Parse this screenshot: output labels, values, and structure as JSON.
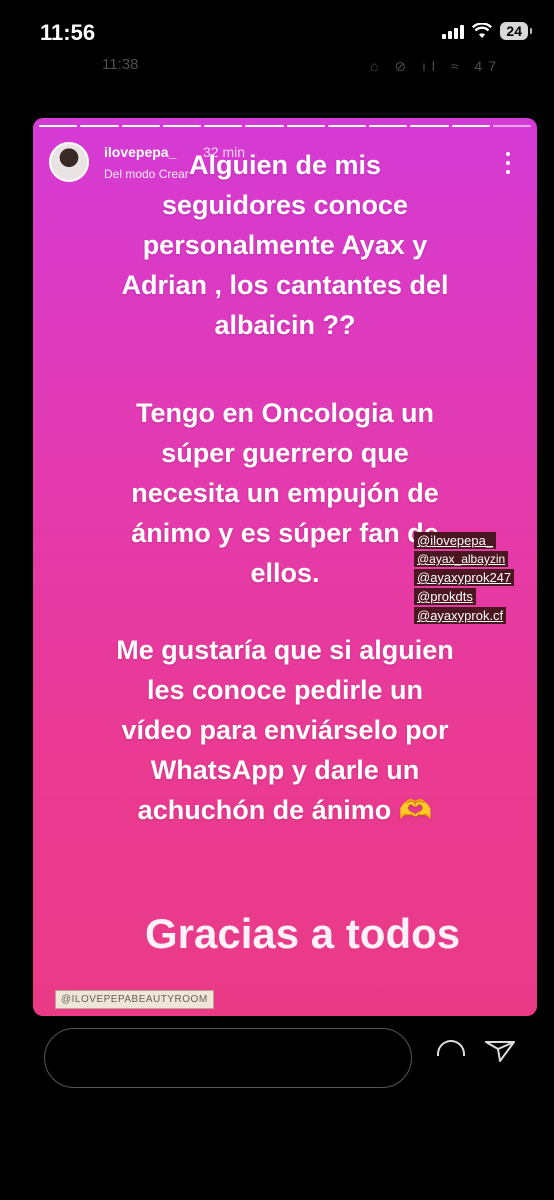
{
  "status_bar": {
    "time": "11:56",
    "battery": "24"
  },
  "ghost_status_bar": {
    "time": "11:38",
    "icons": "⌂ ⊘ ıl ≈ 47"
  },
  "story": {
    "username": "ilovepepa_",
    "posted_ago": "32 min",
    "subtitle": "Del modo Crear",
    "paragraph_1": "Alguien de mis seguidores conoce personalmente Ayax y Adrian , los cantantes del albaicin ??",
    "paragraph_2": "Tengo en Oncologia un súper guerrero que necesita un empujón de ánimo y es súper fan de ellos.",
    "paragraph_3": "Me gustaría que si alguien les conoce pedirle un vídeo para enviárselo por WhatsApp y darle un achuchón de ánimo 🫶",
    "closing": "Gracias a todos",
    "mentions": [
      "@ilovepepa_",
      "@ayax_albayzin",
      "@ayaxyprok247",
      "@prokdts",
      "@ayaxyprok.cf"
    ],
    "watermark": "@ILOVEPEPABEAUTYROOM"
  },
  "colors": {
    "gradient_top": "#d43ad5",
    "gradient_bottom": "#ea3a86",
    "mention_bg": "#4a1620"
  }
}
